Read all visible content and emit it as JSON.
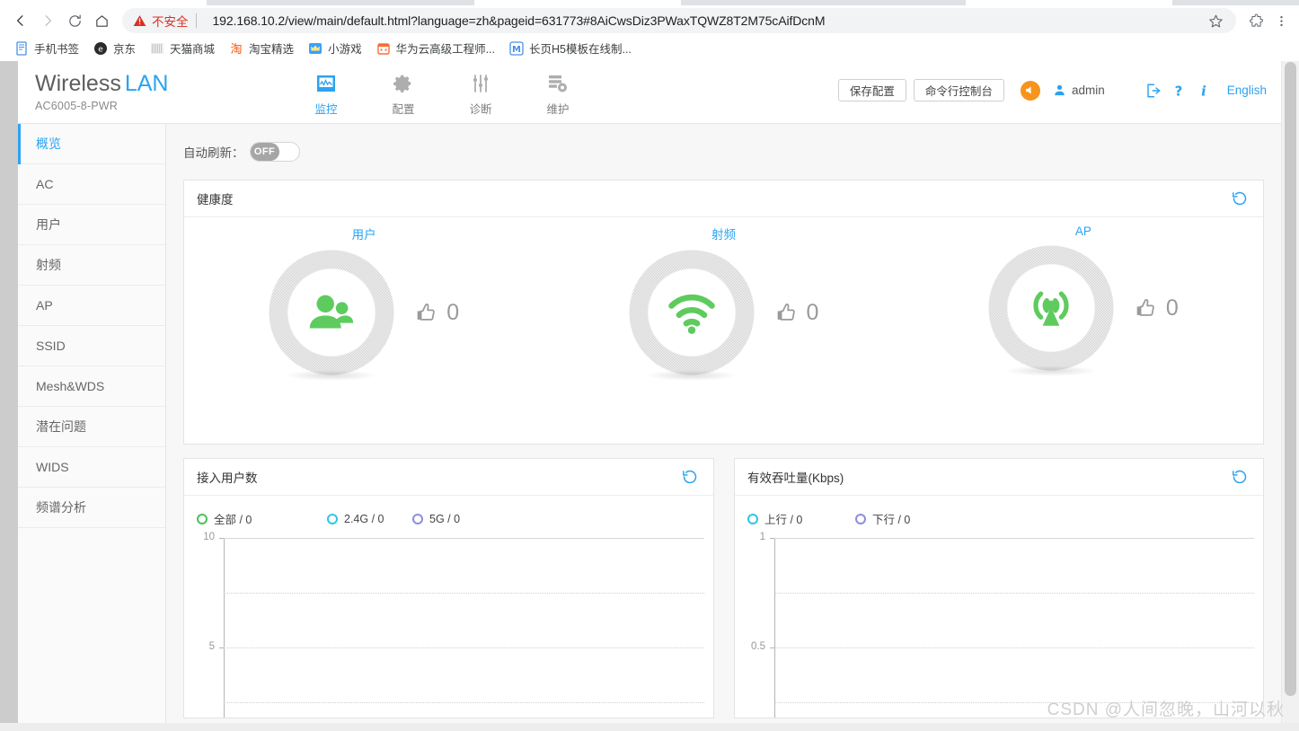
{
  "browser": {
    "nav": {
      "back": "back-arrow",
      "forward": "forward-arrow",
      "reload": "reload",
      "home": "home"
    },
    "security_label": "不安全",
    "url": "192.168.10.2/view/main/default.html?language=zh&pageid=631773#8AiCwsDiz3PWaxTQWZ8T2M75cAifDcnM",
    "bookmarks": [
      {
        "label": "手机书签",
        "icon": "note-icon",
        "color": "#4a90e2"
      },
      {
        "label": "京东",
        "icon": "jd-icon",
        "color": "#2b2b2b"
      },
      {
        "label": "天猫商城",
        "icon": "tmall-icon",
        "color": "#d8d8d8"
      },
      {
        "label": "淘宝精选",
        "icon": "taobao-icon",
        "color": "#ff5000"
      },
      {
        "label": "小游戏",
        "icon": "crown-icon",
        "color": "#3aa0ff"
      },
      {
        "label": "华为云高级工程师...",
        "icon": "calendar-icon",
        "color": "#ff6b35"
      },
      {
        "label": "长页H5模板在线制...",
        "icon": "m-icon",
        "color": "#4a90e2"
      }
    ]
  },
  "header": {
    "brand_primary": "Wireless",
    "brand_secondary": "LAN",
    "model": "AC6005-8-PWR",
    "tabs": [
      {
        "label": "监控",
        "icon": "monitor-icon",
        "active": true
      },
      {
        "label": "配置",
        "icon": "gear-icon",
        "active": false
      },
      {
        "label": "诊断",
        "icon": "sliders-icon",
        "active": false
      },
      {
        "label": "维护",
        "icon": "maintenance-icon",
        "active": false
      }
    ],
    "save_config_label": "保存配置",
    "cli_console_label": "命令行控制台",
    "alarm_icon": "alarm-bell-icon",
    "user_name": "admin",
    "logout_icon": "logout-icon",
    "help_icon": "help-icon",
    "info_icon": "info-icon",
    "language_label": "English"
  },
  "sidebar": {
    "items": [
      {
        "label": "概览",
        "active": true
      },
      {
        "label": "AC",
        "active": false
      },
      {
        "label": "用户",
        "active": false
      },
      {
        "label": "射频",
        "active": false
      },
      {
        "label": "AP",
        "active": false
      },
      {
        "label": "SSID",
        "active": false
      },
      {
        "label": "Mesh&WDS",
        "active": false
      },
      {
        "label": "潜在问题",
        "active": false
      },
      {
        "label": "WIDS",
        "active": false
      },
      {
        "label": "频谱分析",
        "active": false
      }
    ]
  },
  "content": {
    "auto_refresh_label": "自动刷新：",
    "auto_refresh_state": "OFF",
    "health": {
      "title": "健康度",
      "refresh_icon": "refresh-icon",
      "items": [
        {
          "name": "用户",
          "icon": "users-icon",
          "score": "0",
          "thumb_icon": "thumbs-up-icon"
        },
        {
          "name": "射频",
          "icon": "wifi-icon",
          "score": "0",
          "thumb_icon": "thumbs-up-icon"
        },
        {
          "name": "AP",
          "icon": "access-point-icon",
          "score": "0",
          "thumb_icon": "thumbs-up-icon"
        }
      ]
    },
    "users_chart": {
      "title": "接入用户数",
      "refresh_icon": "refresh-icon"
    },
    "throughput_chart": {
      "title": "有效吞吐量(Kbps)",
      "refresh_icon": "refresh-icon"
    }
  },
  "chart_data": [
    {
      "type": "line",
      "title": "接入用户数",
      "xlabel": "",
      "ylabel": "",
      "ylim": [
        0,
        10
      ],
      "yticks": [
        "10",
        "5"
      ],
      "grid": true,
      "legend_position": "top-left",
      "series": [
        {
          "name": "全部 / 0",
          "color": "#4cc15a",
          "values": []
        },
        {
          "name": "2.4G / 0",
          "color": "#2ec4ea",
          "values": []
        },
        {
          "name": "5G / 0",
          "color": "#8a8ee0",
          "values": []
        }
      ],
      "x": []
    },
    {
      "type": "line",
      "title": "有效吞吐量(Kbps)",
      "xlabel": "",
      "ylabel": "",
      "ylim": [
        0,
        1
      ],
      "yticks": [
        "1",
        "0.5"
      ],
      "grid": true,
      "legend_position": "top-left",
      "series": [
        {
          "name": "上行 / 0",
          "color": "#2ec4ea",
          "values": []
        },
        {
          "name": "下行 / 0",
          "color": "#8a8ee0",
          "values": []
        }
      ],
      "x": []
    }
  ],
  "watermark": "CSDN @人间忽晚，山河以秋",
  "colors": {
    "accent": "#2ba3f0",
    "green": "#4cc15a",
    "orange": "#f7941e",
    "warn_red": "#d93025",
    "cyan": "#2ec4ea",
    "purple": "#8a8ee0"
  }
}
